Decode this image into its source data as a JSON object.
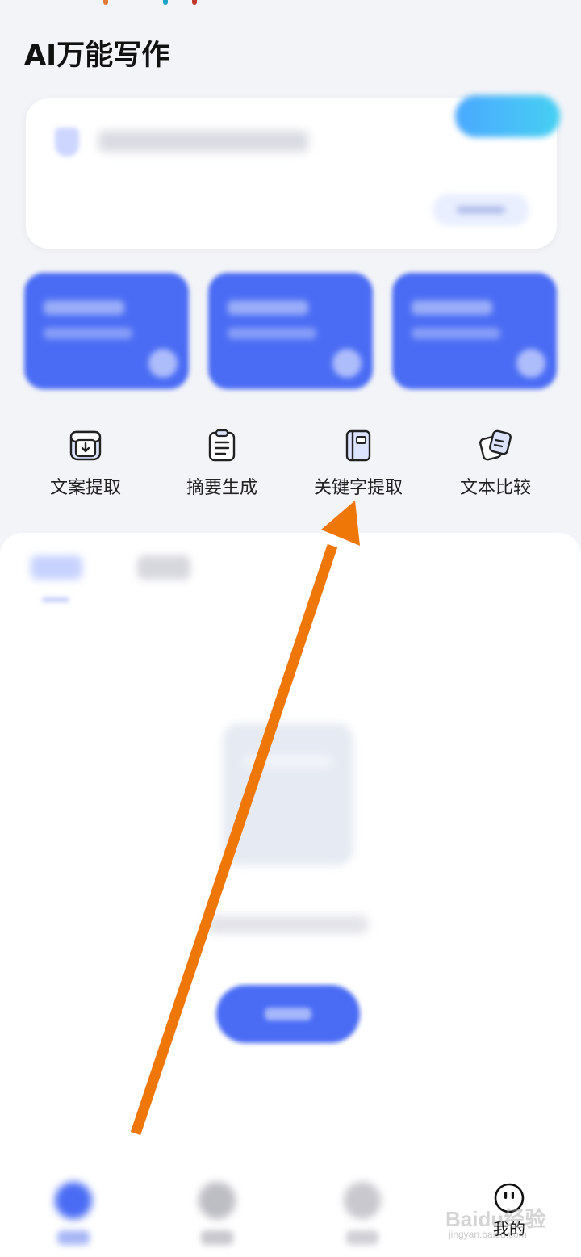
{
  "page": {
    "title": "AI万能写作"
  },
  "tools": [
    {
      "label": "文案提取",
      "icon": "download-box-icon"
    },
    {
      "label": "摘要生成",
      "icon": "clipboard-icon"
    },
    {
      "label": "关键字提取",
      "icon": "notebook-icon"
    },
    {
      "label": "文本比较",
      "icon": "cards-compare-icon"
    }
  ],
  "bottom_nav": {
    "me_label": "我的"
  },
  "watermark": {
    "text": "Baidu经验",
    "sub": "jingyan.baidu.com"
  },
  "colors": {
    "accent": "#4a6cf4",
    "annotation_arrow": "#ee7708"
  }
}
